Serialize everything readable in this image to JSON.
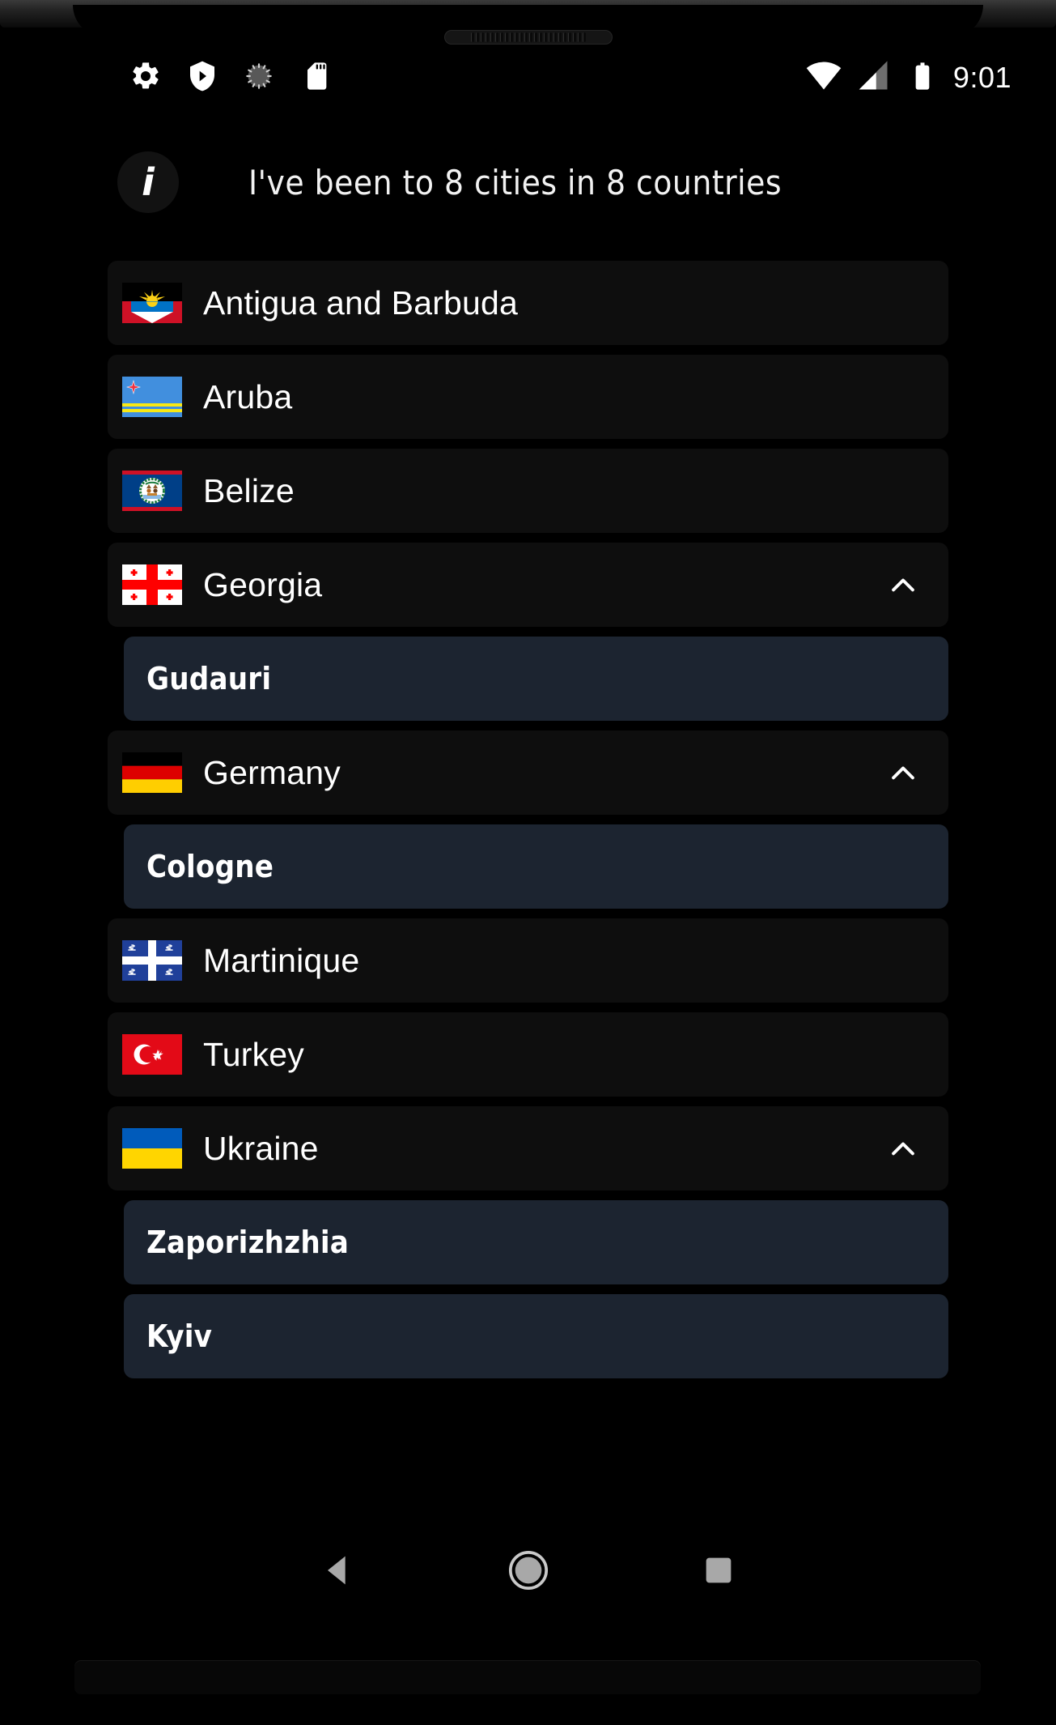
{
  "device": {
    "frame": "phone-bezel",
    "speaker": "speaker-grille"
  },
  "status_bar": {
    "icons_left": [
      "settings-gear-icon",
      "shield-play-icon",
      "sync-spinner-icon",
      "sd-card-icon"
    ],
    "icons_right": [
      "wifi-icon",
      "cellular-signal-icon",
      "battery-icon"
    ],
    "time": "9:01"
  },
  "header": {
    "info_icon": "info-icon",
    "title": "I've been to 8 cities in 8 countries"
  },
  "list": [
    {
      "type": "country",
      "name": "Antigua and Barbuda",
      "flag": "antigua-and-barbuda-flag",
      "expanded": false
    },
    {
      "type": "country",
      "name": "Aruba",
      "flag": "aruba-flag",
      "expanded": false
    },
    {
      "type": "country",
      "name": "Belize",
      "flag": "belize-flag",
      "expanded": false
    },
    {
      "type": "country",
      "name": "Georgia",
      "flag": "georgia-flag",
      "expanded": true,
      "chevron": "chevron-up-icon"
    },
    {
      "type": "city",
      "name": "Gudauri"
    },
    {
      "type": "country",
      "name": "Germany",
      "flag": "germany-flag",
      "expanded": true,
      "chevron": "chevron-up-icon"
    },
    {
      "type": "city",
      "name": "Cologne"
    },
    {
      "type": "country",
      "name": "Martinique",
      "flag": "martinique-flag",
      "expanded": false
    },
    {
      "type": "country",
      "name": "Turkey",
      "flag": "turkey-flag",
      "expanded": false
    },
    {
      "type": "country",
      "name": "Ukraine",
      "flag": "ukraine-flag",
      "expanded": true,
      "chevron": "chevron-up-icon"
    },
    {
      "type": "city",
      "name": "Zaporizhzhia"
    },
    {
      "type": "city",
      "name": "Kyiv"
    }
  ],
  "nav_bar": {
    "back": "back-triangle-icon",
    "home": "home-circle-icon",
    "recents": "recents-square-icon"
  },
  "colors": {
    "background": "#000000",
    "country_row": "#0e0e0e",
    "city_row": "#1c2430",
    "text": "#ffffff",
    "nav_icon": "#a8a8a8"
  }
}
